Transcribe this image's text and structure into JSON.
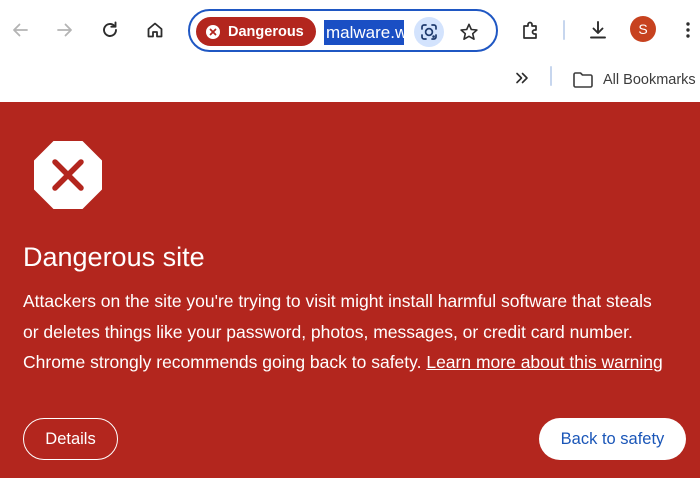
{
  "toolbar": {
    "icons": [
      "back-arrow-icon",
      "forward-arrow-icon",
      "reload-icon",
      "home-icon",
      "extensions-icon",
      "download-icon",
      "more-vert-icon"
    ],
    "avatar_initial": "S"
  },
  "omnibox": {
    "security_chip_label": "Dangerous",
    "url_text": "malware.w",
    "url_selected": true
  },
  "bookmarks_bar": {
    "all_bookmarks_label": "All Bookmarks"
  },
  "interstitial": {
    "heading": "Dangerous site",
    "body_lines": [
      "Attackers on the site you're trying to visit might install harmful software that steals",
      "or deletes things like your password, photos, messages, or credit card number.",
      "Chrome strongly recommends going back to safety."
    ],
    "learn_more_link": "Learn more about this warning",
    "details_button": "Details",
    "back_to_safety_button": "Back to safety"
  },
  "colors": {
    "danger_red": "#b3261e",
    "omnibox_focus_blue": "#1f57c3",
    "url_selection_blue": "#1a4fc4",
    "safety_button_text": "#1a56b8",
    "avatar_bg": "#c7421f"
  }
}
